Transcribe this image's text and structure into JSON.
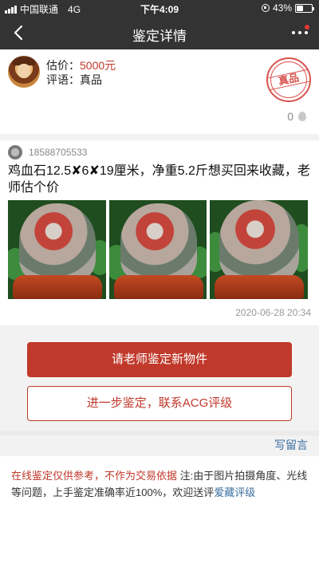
{
  "status_bar": {
    "carrier": "中国联通",
    "network": "4G",
    "time": "下午4:09",
    "battery": "43%",
    "battery_level": 0.43
  },
  "nav": {
    "title": "鉴定详情"
  },
  "appraisal": {
    "estimate_label": "估价：",
    "estimate_value": "5000元",
    "comment_label": "评语：",
    "comment_value": "真品",
    "stamp_text": "真品",
    "like_count": "0"
  },
  "post": {
    "user_phone": "18588705533",
    "question": "鸡血石12.5✘6✘19厘米，净重5.2斤想买回来收藏，老师估个价",
    "photos": [
      "stone-photo-1",
      "stone-photo-2",
      "stone-photo-3"
    ],
    "time": "2020-06-28 20:34"
  },
  "actions": {
    "primary_label": "请老师鉴定新物件",
    "secondary_label": "进一步鉴定，联系ACG评级",
    "write_comment": "写留言"
  },
  "notice": {
    "warning": "在线鉴定仅供参考，不作为交易依据",
    "text": " 注:由于图片拍摄角度、光线等问题，上手鉴定准确率近100%，欢迎送评",
    "link": "爱藏评级"
  },
  "colors": {
    "brand": "#c0392b",
    "header": "#333333",
    "link": "#3b6fa0"
  }
}
